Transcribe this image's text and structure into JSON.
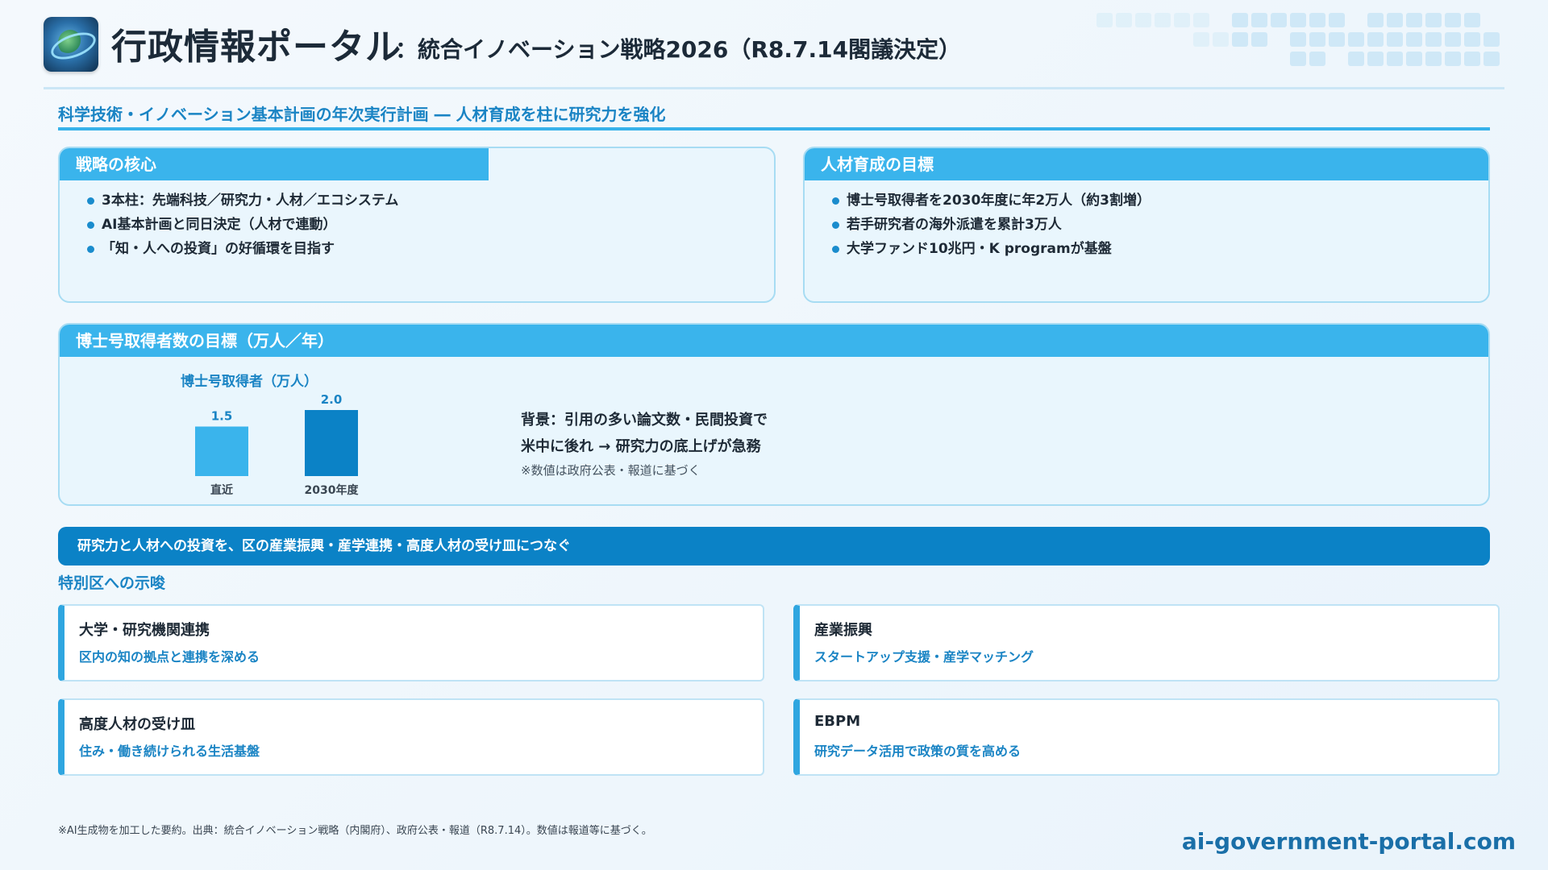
{
  "header": {
    "title": "行政情報ポータル",
    "subtitle": "：統合イノベーション戦略2026（R8.7.14閣議決定）"
  },
  "headline": "科学技術・イノベーション基本計画の年次実行計画 ― 人材育成を柱に研究力を強化",
  "core": {
    "heading": "戦略の核心",
    "items": [
      "3本柱：先端科技／研究力・人材／エコシステム",
      "AI基本計画と同日決定（人材で連動）",
      "「知・人への投資」の好循環を目指す"
    ]
  },
  "talent": {
    "heading": "人材育成の目標",
    "items": [
      "博士号取得者を2030年度に年2万人（約3割増）",
      "若手研究者の海外派遣を累計3万人",
      "大学ファンド10兆円・K programが基盤"
    ]
  },
  "phd_panel": {
    "heading": "博士号取得者数の目標（万人／年）",
    "background_line1": "背景：引用の多い論文数・民間投資で",
    "background_line2": "米中に後れ → 研究力の底上げが急務",
    "note": "※数値は政府公表・報道に基づく"
  },
  "chart_data": {
    "type": "bar",
    "title": "博士号取得者（万人）",
    "categories": [
      "直近",
      "2030年度"
    ],
    "values": [
      1.5,
      2.0
    ],
    "value_labels": [
      "1.5",
      "2.0"
    ],
    "bar_colors": [
      "#3ab4ec",
      "#0b82c6"
    ],
    "ylim": [
      0,
      2.0
    ],
    "grid": false
  },
  "banner": "研究力と人材への投資を、区の産業振興・産学連携・高度人材の受け皿につなぐ",
  "implications": {
    "label": "特別区への示唆",
    "tiles": [
      {
        "title": "大学・研究機関連携",
        "desc": "区内の知の拠点と連携を深める"
      },
      {
        "title": "産業振興",
        "desc": "スタートアップ支援・産学マッチング"
      },
      {
        "title": "高度人材の受け皿",
        "desc": "住み・働き続けられる生活基盤"
      },
      {
        "title": "EBPM",
        "desc": "研究データ活用で政策の質を高める"
      }
    ]
  },
  "footer": {
    "note": "※AI生成物を加工した要約。出典：統合イノベーション戦略（内閣府）、政府公表・報道（R8.7.14）。数値は報道等に基づく。",
    "domain": "ai-government-portal.com"
  },
  "colors": {
    "accent": "#3ab4ec",
    "accent_dark": "#0b82c6",
    "text": "#1e2a36"
  }
}
